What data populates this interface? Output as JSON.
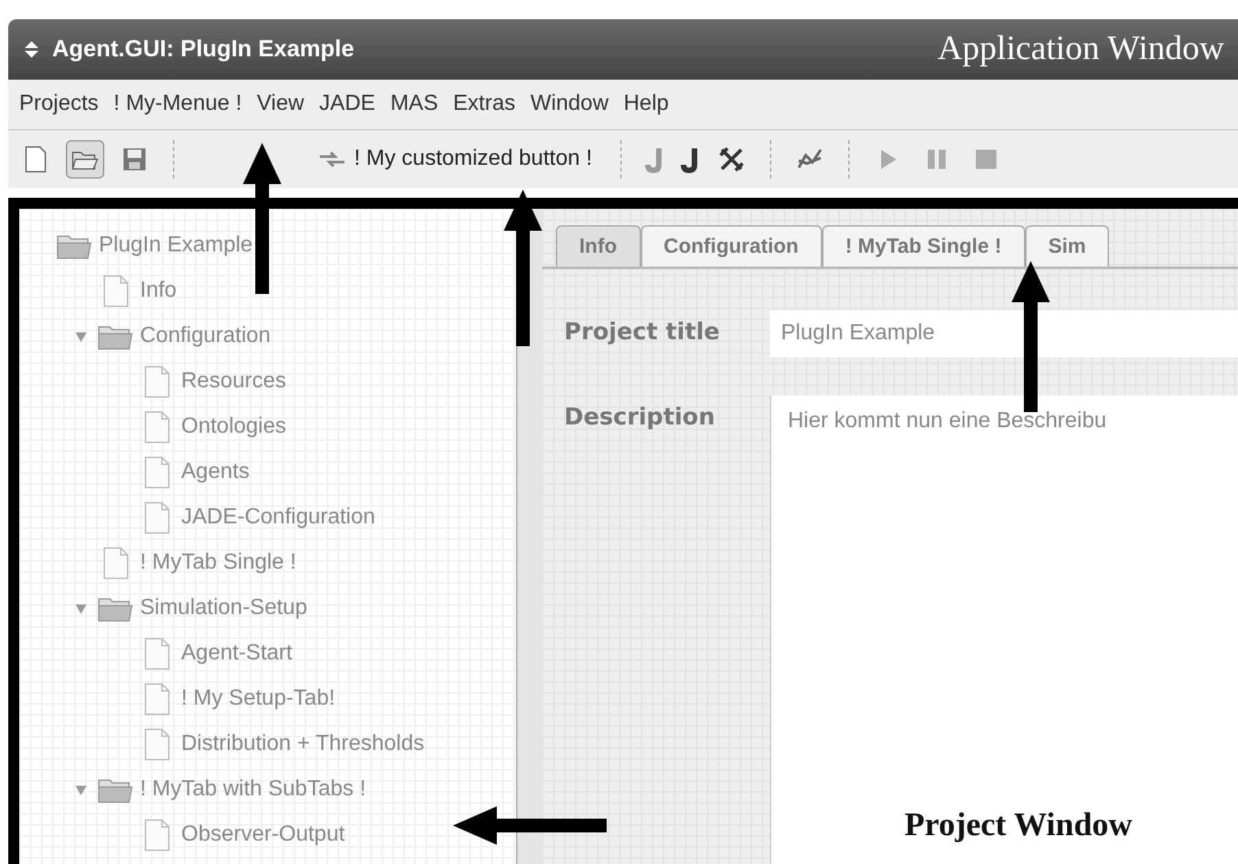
{
  "window": {
    "title": "Agent.GUI: PlugIn Example",
    "caption": "Application Window"
  },
  "menu": [
    "Projects",
    "! My-Menue !",
    "View",
    "JADE",
    "MAS",
    "Extras",
    "Window",
    "Help"
  ],
  "toolbar": [
    {
      "kind": "new",
      "selected": false
    },
    {
      "kind": "open",
      "selected": true
    },
    {
      "kind": "save",
      "selected": false
    },
    {
      "kind": "separator"
    },
    {
      "kind": "custom",
      "label": "! My customized button !",
      "selected": false
    },
    {
      "kind": "separator"
    },
    {
      "kind": "jade-light",
      "selected": false
    },
    {
      "kind": "jade",
      "selected": false
    },
    {
      "kind": "tools",
      "selected": false
    },
    {
      "kind": "separator"
    },
    {
      "kind": "graph",
      "selected": false
    },
    {
      "kind": "separator"
    },
    {
      "kind": "play",
      "selected": false
    },
    {
      "kind": "pause",
      "selected": false
    },
    {
      "kind": "stop",
      "selected": false
    }
  ],
  "tree": [
    {
      "label": "PlugIn Example",
      "children": [
        {
          "label": "Info"
        },
        {
          "label": "Configuration",
          "expanded": true,
          "children": [
            {
              "label": "Resources"
            },
            {
              "label": "Ontologies"
            },
            {
              "label": "Agents"
            },
            {
              "label": "JADE-Configuration"
            }
          ]
        },
        {
          "label": "! MyTab Single !"
        },
        {
          "label": "Simulation-Setup",
          "expanded": true,
          "children": [
            {
              "label": "Agent-Start"
            },
            {
              "label": "! My Setup-Tab!"
            },
            {
              "label": "Distribution + Thresholds"
            }
          ]
        },
        {
          "label": "! MyTab with SubTabs !",
          "expanded": true,
          "children": [
            {
              "label": "Observer-Output"
            }
          ]
        }
      ]
    }
  ],
  "tabs": [
    {
      "label": "Info",
      "selected": true
    },
    {
      "label": "Configuration",
      "selected": false
    },
    {
      "label": "! MyTab Single !",
      "selected": false
    },
    {
      "label": "Sim",
      "selected": false
    }
  ],
  "form": {
    "project_title": {
      "label": "Project title",
      "value": "PlugIn Example"
    },
    "description": {
      "label": "Description",
      "value": "Hier kommt nun eine Beschreibu"
    }
  },
  "annotation": "Project Window"
}
